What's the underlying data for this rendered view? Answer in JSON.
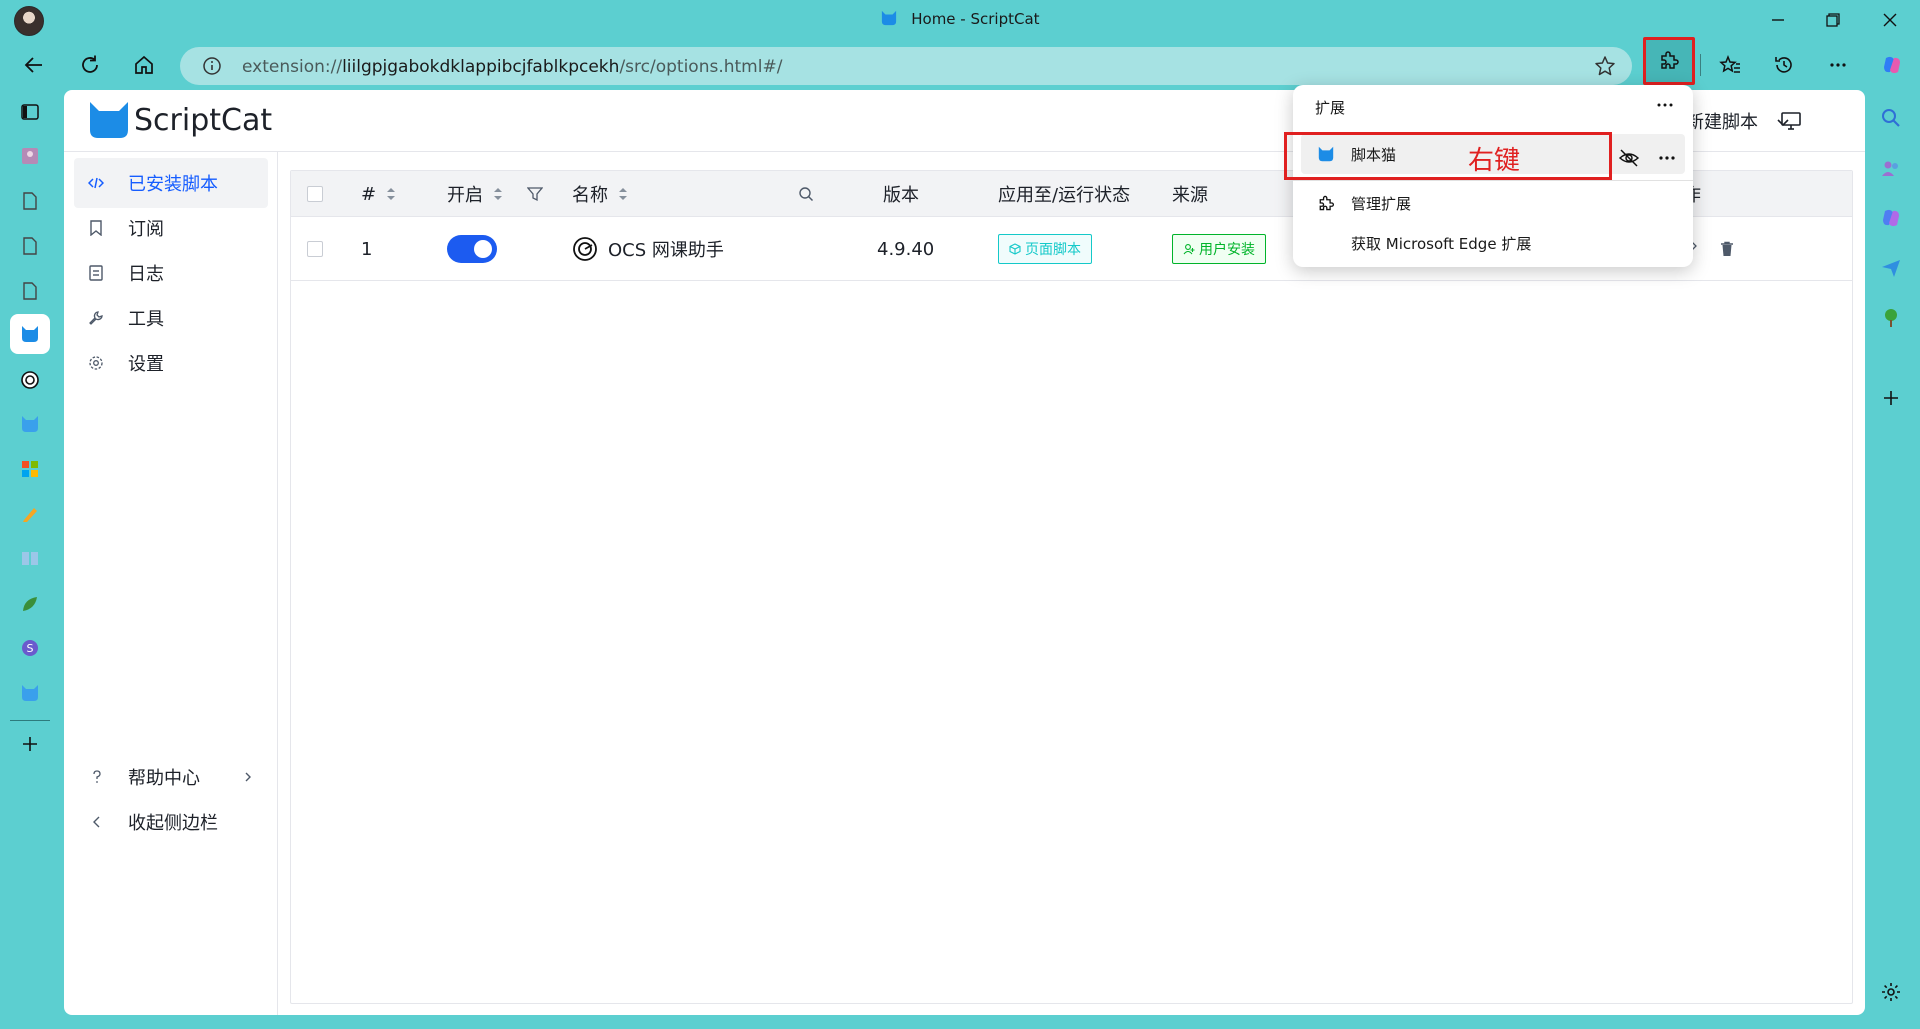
{
  "window": {
    "title": "Home - ScriptCat"
  },
  "address_bar": {
    "url_prefix": "extension://",
    "url_host": "liilgpjgabokdklappibcjfablkpcekh",
    "url_path": "/src/options.html#/"
  },
  "app": {
    "name": "ScriptCat",
    "header_action": "新建脚本"
  },
  "menu": {
    "items": [
      {
        "label": "已安装脚本",
        "icon": "code-icon"
      },
      {
        "label": "订阅",
        "icon": "bookmark-icon"
      },
      {
        "label": "日志",
        "icon": "log-icon"
      },
      {
        "label": "工具",
        "icon": "wrench-icon"
      },
      {
        "label": "设置",
        "icon": "gear-icon"
      }
    ],
    "help": "帮助中心",
    "collapse": "收起侧边栏"
  },
  "table": {
    "headers": {
      "index": "#",
      "enabled": "开启",
      "name": "名称",
      "version": "版本",
      "apply": "应用至/运行状态",
      "source": "来源",
      "action": "作"
    },
    "rows": [
      {
        "index": "1",
        "enabled": true,
        "name": "OCS 网课助手",
        "version": "4.9.40",
        "apply_tag": "页面脚本",
        "source_tag": "用户安装"
      }
    ]
  },
  "extensions_popup": {
    "title": "扩展",
    "items": [
      {
        "label": "脚本猫"
      },
      {
        "label": "管理扩展"
      },
      {
        "label": "获取 Microsoft Edge 扩展"
      }
    ],
    "annotation": "右键"
  },
  "colors": {
    "browser_frame": "#5ccfd0",
    "accent_blue": "#165dff",
    "highlight_red": "#e02020"
  }
}
